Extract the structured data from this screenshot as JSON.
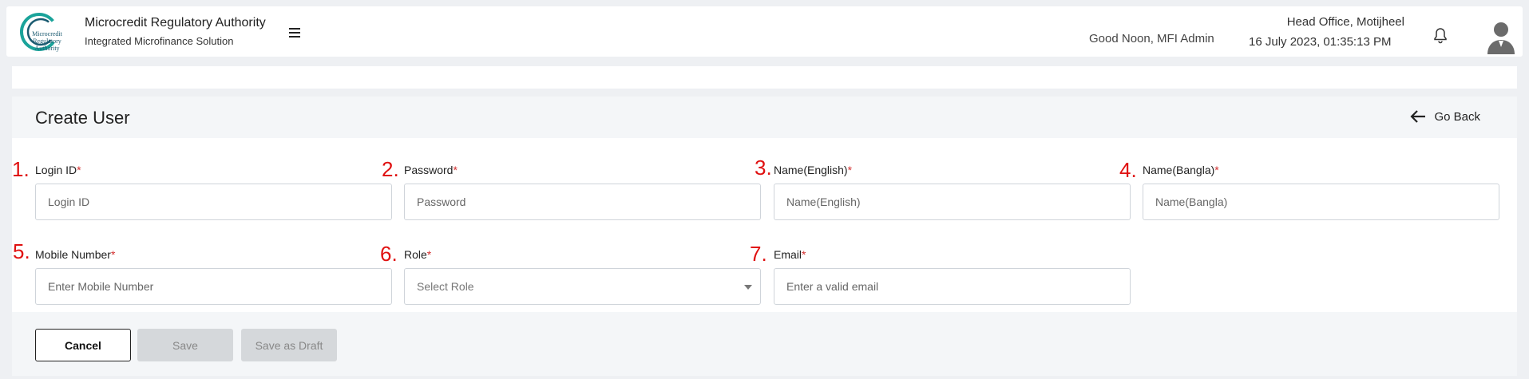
{
  "header": {
    "logo_text": "Microcredit Regulatory Authority",
    "app_title": "Microcredit Regulatory Authority",
    "app_subtitle": "Integrated Microfinance Solution",
    "greeting": "Good Noon, MFI Admin",
    "office": "Head Office, Motijheel",
    "datetime": "16 July 2023, 01:35:13 PM"
  },
  "page": {
    "title": "Create User",
    "go_back": "Go Back"
  },
  "form": {
    "required_mark": "*",
    "fields": [
      {
        "number": "1.",
        "label": "Login ID",
        "placeholder": "Login ID"
      },
      {
        "number": "2.",
        "label": "Password",
        "placeholder": "Password"
      },
      {
        "number": "3.",
        "label": "Name(English)",
        "placeholder": "Name(English)"
      },
      {
        "number": "4.",
        "label": "Name(Bangla)",
        "placeholder": "Name(Bangla)"
      },
      {
        "number": "5.",
        "label": "Mobile Number",
        "placeholder": "Enter Mobile Number"
      },
      {
        "number": "6.",
        "label": "Role",
        "placeholder": "Select Role"
      },
      {
        "number": "7.",
        "label": "Email",
        "placeholder": "Enter a valid email"
      }
    ]
  },
  "buttons": {
    "cancel": "Cancel",
    "save": "Save",
    "save_draft": "Save as Draft"
  },
  "colors": {
    "required": "#d32f2f",
    "annotation": "#e01010",
    "logo_ring": "#1aa39a"
  }
}
